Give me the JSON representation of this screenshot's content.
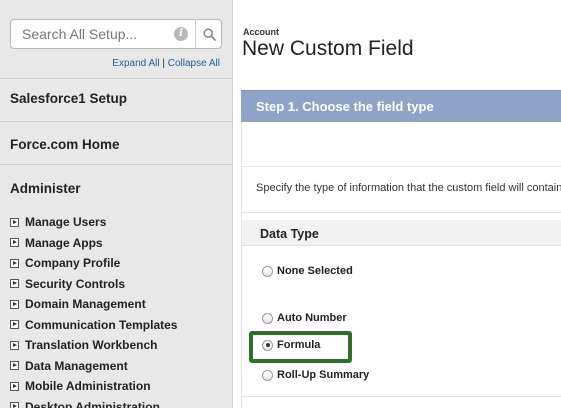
{
  "sidebar": {
    "search": {
      "placeholder": "Search All Setup...",
      "info_icon": "info-icon",
      "search_icon": "search-icon"
    },
    "expand_all": "Expand All",
    "separator": "|",
    "collapse_all": "Collapse All",
    "sections": [
      {
        "label": "Salesforce1 Setup"
      },
      {
        "label": "Force.com Home"
      },
      {
        "label": "Administer"
      }
    ],
    "menu": [
      {
        "label": "Manage Users"
      },
      {
        "label": "Manage Apps"
      },
      {
        "label": "Company Profile"
      },
      {
        "label": "Security Controls"
      },
      {
        "label": "Domain Management"
      },
      {
        "label": "Communication Templates"
      },
      {
        "label": "Translation Workbench"
      },
      {
        "label": "Data Management"
      },
      {
        "label": "Mobile Administration"
      },
      {
        "label": "Desktop Administration"
      }
    ]
  },
  "main": {
    "breadcrumb": "Account",
    "title": "New Custom Field",
    "step_title": "Step 1. Choose the field type",
    "description": "Specify the type of information that the custom field will contain.",
    "data_type_header": "Data Type",
    "options": [
      {
        "label": "None Selected",
        "checked": false
      },
      {
        "label": "Auto Number",
        "checked": false
      },
      {
        "label": "Formula",
        "checked": true
      },
      {
        "label": "Roll-Up Summary",
        "checked": false
      }
    ],
    "highlight_color": "#2f6f2a",
    "step_bar_color": "#8fa3c8"
  }
}
